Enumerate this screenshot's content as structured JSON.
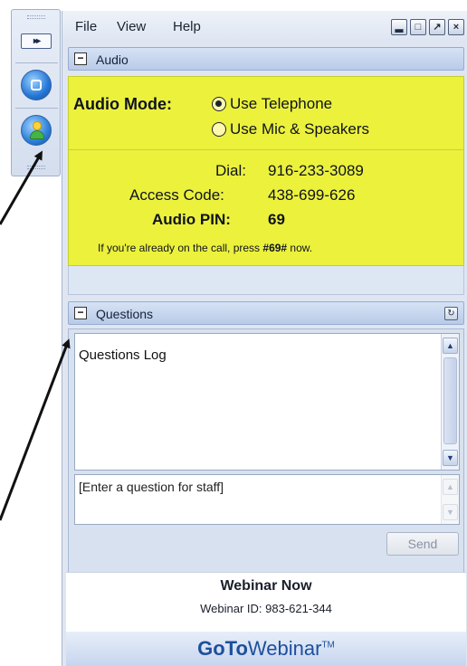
{
  "menu": {
    "file": "File",
    "view": "View",
    "help": "Help"
  },
  "window_buttons": {
    "minimize": "▂",
    "restore": "□",
    "popout": "↗",
    "close": "×"
  },
  "dock": {
    "expand_glyph": "▸▸"
  },
  "audio": {
    "header": "Audio",
    "collapse_glyph": "−",
    "mode_label": "Audio Mode:",
    "options": [
      "Use Telephone",
      "Use Mic & Speakers"
    ],
    "selected_option": "Use Telephone",
    "dial_label": "Dial:",
    "dial_value": "916-233-3089",
    "access_label": "Access Code:",
    "access_value": "438-699-626",
    "pin_label": "Audio PIN:",
    "pin_value": "69",
    "note_prefix": "If you're already on the call, press ",
    "note_code": "#69#",
    "note_suffix": " now."
  },
  "questions": {
    "header": "Questions",
    "collapse_glyph": "−",
    "refresh_glyph": "↻",
    "log_label": "Questions Log",
    "input_placeholder": "[Enter a question for staff]",
    "send_label": "Send",
    "scroll_up_glyph": "▲",
    "scroll_down_glyph": "▼"
  },
  "webinar": {
    "title": "Webinar Now",
    "id_text": "Webinar ID: 983-621-344"
  },
  "brand": {
    "goto": "GoTo",
    "webinar": "Webinar",
    "tm": "TM"
  },
  "colors": {
    "audio_panel_bg": "#ecf13c",
    "header_blue": "#b9cbe8",
    "brand_blue": "#1d4f9c"
  }
}
